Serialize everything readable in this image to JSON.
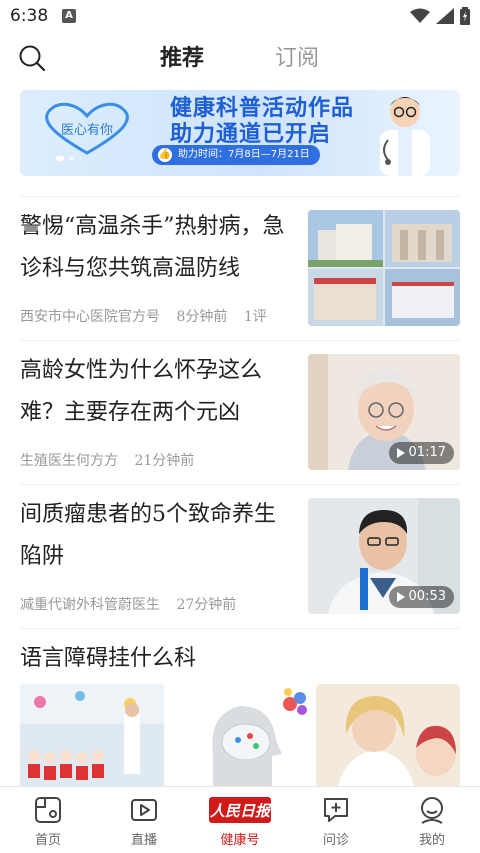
{
  "status_bar": {
    "time": "6:38",
    "notif_icon": "a-notification-icon",
    "icons": [
      "wifi-icon",
      "signal-icon",
      "battery-icon"
    ]
  },
  "header": {
    "search_icon": "search-icon",
    "tabs": [
      {
        "label": "推荐",
        "active": true
      },
      {
        "label": "订阅",
        "active": false
      }
    ]
  },
  "banner": {
    "logo_text": "医心有你",
    "title_line1": "健康科普活动作品",
    "title_line2": "助力通道已开启",
    "time_label": "助力时间：7月8日—7月21日"
  },
  "articles": [
    {
      "title": "警惕“高温杀手”热射病，急诊科与您共筑高温防线",
      "source": "西安市中心医院官方号",
      "time": "8分钟前",
      "comments": "1评",
      "thumb_type": "hospital-collage"
    },
    {
      "title": "高龄女性为什么怀孕这么难？主要存在两个元凶",
      "source": "生殖医生何方方",
      "time": "21分钟前",
      "duration": "01:17",
      "thumb_type": "video"
    },
    {
      "title": "间质瘤患者的5个致命养生陷阱",
      "source": "减重代谢外科管蔚医生",
      "time": "27分钟前",
      "duration": "00:53",
      "thumb_type": "video"
    }
  ],
  "section": {
    "title": "语言障碍挂什么科"
  },
  "bottom_nav": {
    "items": [
      {
        "label": "首页",
        "icon": "home-icon",
        "active": false
      },
      {
        "label": "直播",
        "icon": "live-icon",
        "active": false
      },
      {
        "label": "健康号",
        "icon": "rmrb-logo-icon",
        "active": true,
        "logo_text": "人民日报"
      },
      {
        "label": "问诊",
        "icon": "consult-icon",
        "active": false
      },
      {
        "label": "我的",
        "icon": "profile-icon",
        "active": false
      }
    ]
  },
  "colors": {
    "accent_red": "#d21a1a",
    "banner_blue": "#1f5fd4",
    "text_gray": "#999999"
  }
}
